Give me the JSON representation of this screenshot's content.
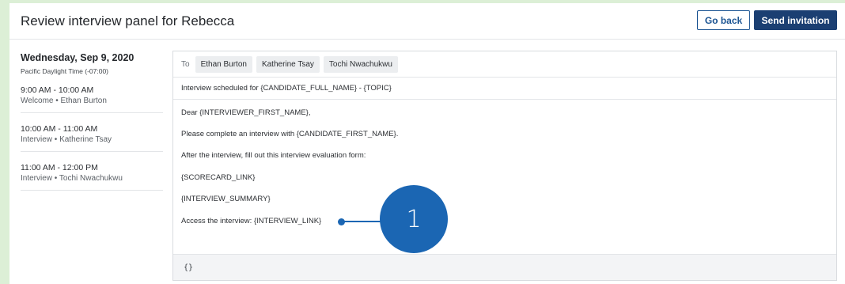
{
  "header": {
    "title": "Review interview panel for Rebecca",
    "back_label": "Go back",
    "send_label": "Send invitation"
  },
  "schedule": {
    "date": "Wednesday, Sep 9, 2020",
    "timezone": "Pacific Daylight Time (-07:00)",
    "slots": [
      {
        "time": "9:00 AM - 10:00 AM",
        "desc": "Welcome • Ethan Burton"
      },
      {
        "time": "10:00 AM - 11:00 AM",
        "desc": "Interview • Katherine Tsay"
      },
      {
        "time": "11:00 AM - 12:00 PM",
        "desc": "Interview • Tochi Nwachukwu"
      }
    ]
  },
  "email": {
    "to_label": "To",
    "recipients": [
      "Ethan Burton",
      "Katherine Tsay",
      "Tochi Nwachukwu"
    ],
    "subject": "Interview scheduled for {CANDIDATE_FULL_NAME} - {TOPIC}",
    "body": [
      "Dear {INTERVIEWER_FIRST_NAME},",
      "Please complete an interview with {CANDIDATE_FIRST_NAME}.",
      "After the interview, fill out this interview evaluation form:",
      "{SCORECARD_LINK}",
      "{INTERVIEW_SUMMARY}",
      "Access the interview: {INTERVIEW_LINK}"
    ],
    "footer_token": "{}"
  },
  "callout": {
    "number": "1",
    "color": "#1b66b3"
  },
  "colors": {
    "background": "#dcefd6",
    "primary_button": "#1b3f72",
    "outline_button": "#1c5593"
  }
}
